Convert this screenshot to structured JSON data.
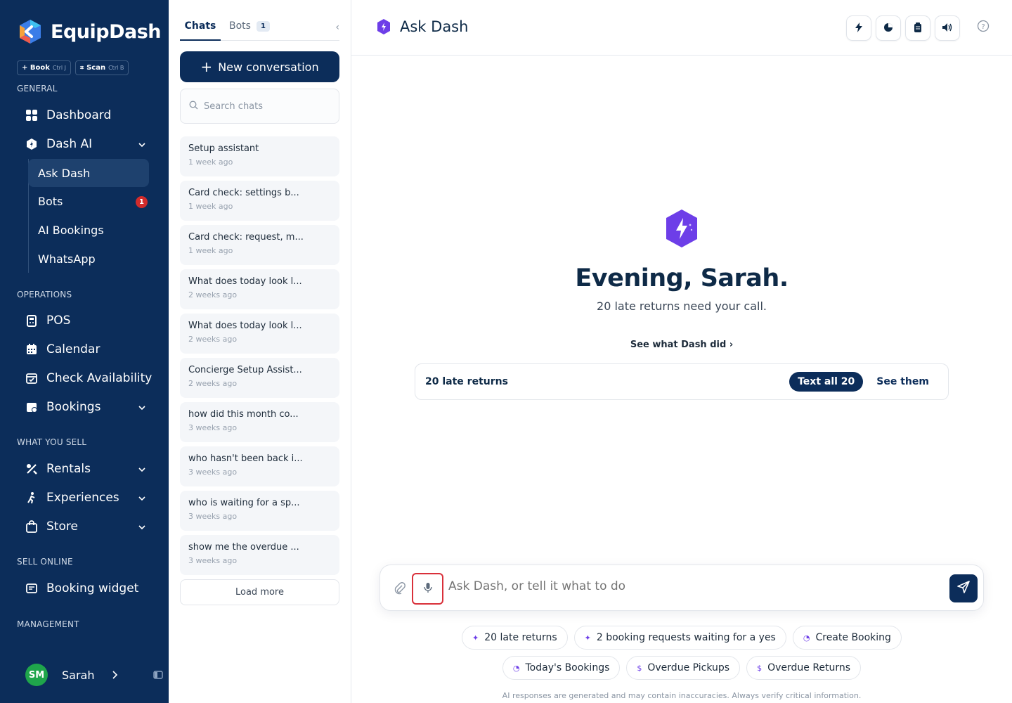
{
  "brand": {
    "name": "EquipDash"
  },
  "quick": [
    {
      "label": "+ Book",
      "kbd": "Ctrl J"
    },
    {
      "label": "Scan",
      "kbd": "Ctrl B"
    }
  ],
  "sidebar": {
    "sections": {
      "general": "GENERAL",
      "operations": "OPERATIONS",
      "what_you_sell": "WHAT YOU SELL",
      "sell_online": "SELL ONLINE",
      "management": "MANAGEMENT"
    },
    "dashboard": "Dashboard",
    "dash_ai": "Dash AI",
    "sub": {
      "ask": "Ask Dash",
      "bots": "Bots",
      "bots_badge": "1",
      "ai_bookings": "AI Bookings",
      "whatsapp": "WhatsApp"
    },
    "pos": "POS",
    "calendar": "Calendar",
    "check": "Check Availability",
    "bookings": "Bookings",
    "rentals": "Rentals",
    "experiences": "Experiences",
    "store": "Store",
    "widget": "Booking widget",
    "user": {
      "initials": "SM",
      "name": "Sarah"
    }
  },
  "chats": {
    "tab_chats": "Chats",
    "tab_bots": "Bots",
    "bots_count": "1",
    "new_conversation": "New conversation",
    "search_placeholder": "Search chats",
    "items": [
      {
        "title": "Setup assistant",
        "date": "1 week ago"
      },
      {
        "title": "Card check: settings b...",
        "date": "1 week ago"
      },
      {
        "title": "Card check: request, m...",
        "date": "1 week ago"
      },
      {
        "title": "What does today look l...",
        "date": "2 weeks ago"
      },
      {
        "title": "What does today look l...",
        "date": "2 weeks ago"
      },
      {
        "title": "Concierge Setup Assist...",
        "date": "2 weeks ago"
      },
      {
        "title": "how did this month co...",
        "date": "3 weeks ago"
      },
      {
        "title": "who hasn't been back i...",
        "date": "3 weeks ago"
      },
      {
        "title": "who is waiting for a sp...",
        "date": "3 weeks ago"
      },
      {
        "title": "show me the overdue ...",
        "date": "3 weeks ago"
      }
    ],
    "load_more": "Load more"
  },
  "main": {
    "title": "Ask Dash",
    "greeting": "Evening, Sarah.",
    "subtitle": "20 late returns need your call.",
    "see_what": "See what Dash did",
    "card": {
      "label": "20 late returns",
      "primary": "Text all 20",
      "secondary": "See them"
    },
    "input_placeholder": "Ask Dash, or tell it what to do",
    "chips": [
      {
        "icon": "✦",
        "label": "20 late returns"
      },
      {
        "icon": "✦",
        "label": "2 booking requests waiting for a yes"
      },
      {
        "icon": "◔",
        "label": "Create Booking"
      },
      {
        "icon": "◔",
        "label": "Today's Bookings"
      },
      {
        "icon": "$",
        "label": "Overdue Pickups"
      },
      {
        "icon": "$",
        "label": "Overdue Returns"
      }
    ],
    "disclaimer": "AI responses are generated and may contain inaccuracies. Always verify critical information."
  },
  "colors": {
    "navy": "#0c2d5a",
    "accent": "#6d3ee8",
    "badge": "#d22b2b",
    "avatar": "#1fa54b"
  }
}
